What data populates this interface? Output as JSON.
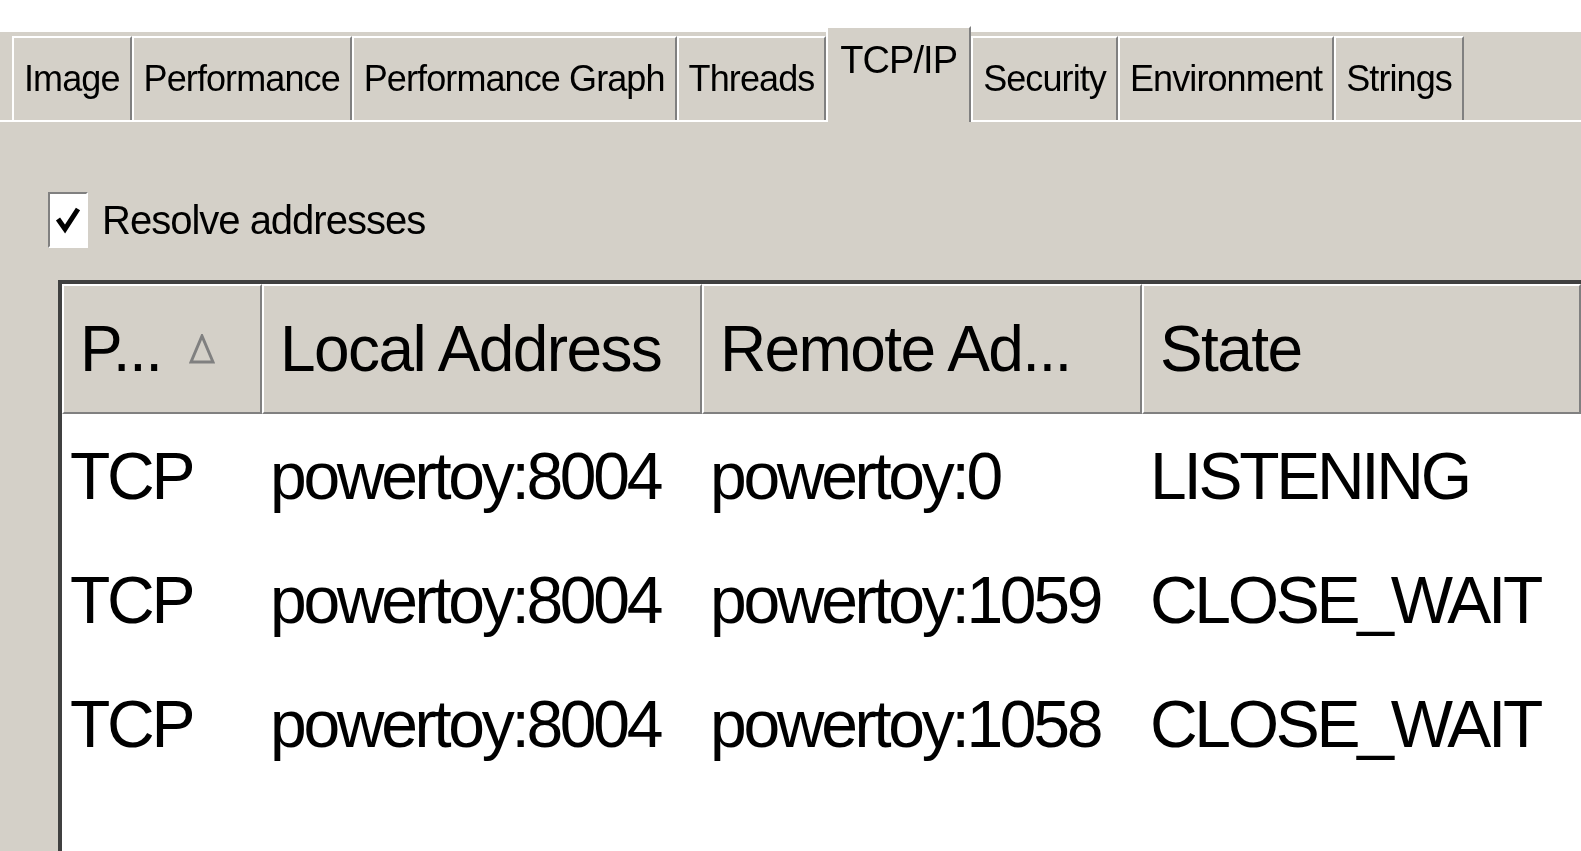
{
  "tabs": [
    {
      "label": "Image",
      "selected": false
    },
    {
      "label": "Performance",
      "selected": false
    },
    {
      "label": "Performance Graph",
      "selected": false
    },
    {
      "label": "Threads",
      "selected": false
    },
    {
      "label": "TCP/IP",
      "selected": true
    },
    {
      "label": "Security",
      "selected": false
    },
    {
      "label": "Environment",
      "selected": false
    },
    {
      "label": "Strings",
      "selected": false
    }
  ],
  "resolve_addresses": {
    "label": "Resolve addresses",
    "checked": true
  },
  "table": {
    "columns": [
      {
        "label": "P...",
        "sorted": true
      },
      {
        "label": "Local Address",
        "sorted": false
      },
      {
        "label": "Remote Ad...",
        "sorted": false
      },
      {
        "label": "State",
        "sorted": false
      }
    ],
    "rows": [
      [
        "TCP",
        "powertoy:8004",
        "powertoy:0",
        "LISTENING"
      ],
      [
        "TCP",
        "powertoy:8004",
        "powertoy:1059",
        "CLOSE_WAIT"
      ],
      [
        "TCP",
        "powertoy:8004",
        "powertoy:1058",
        "CLOSE_WAIT"
      ]
    ]
  }
}
